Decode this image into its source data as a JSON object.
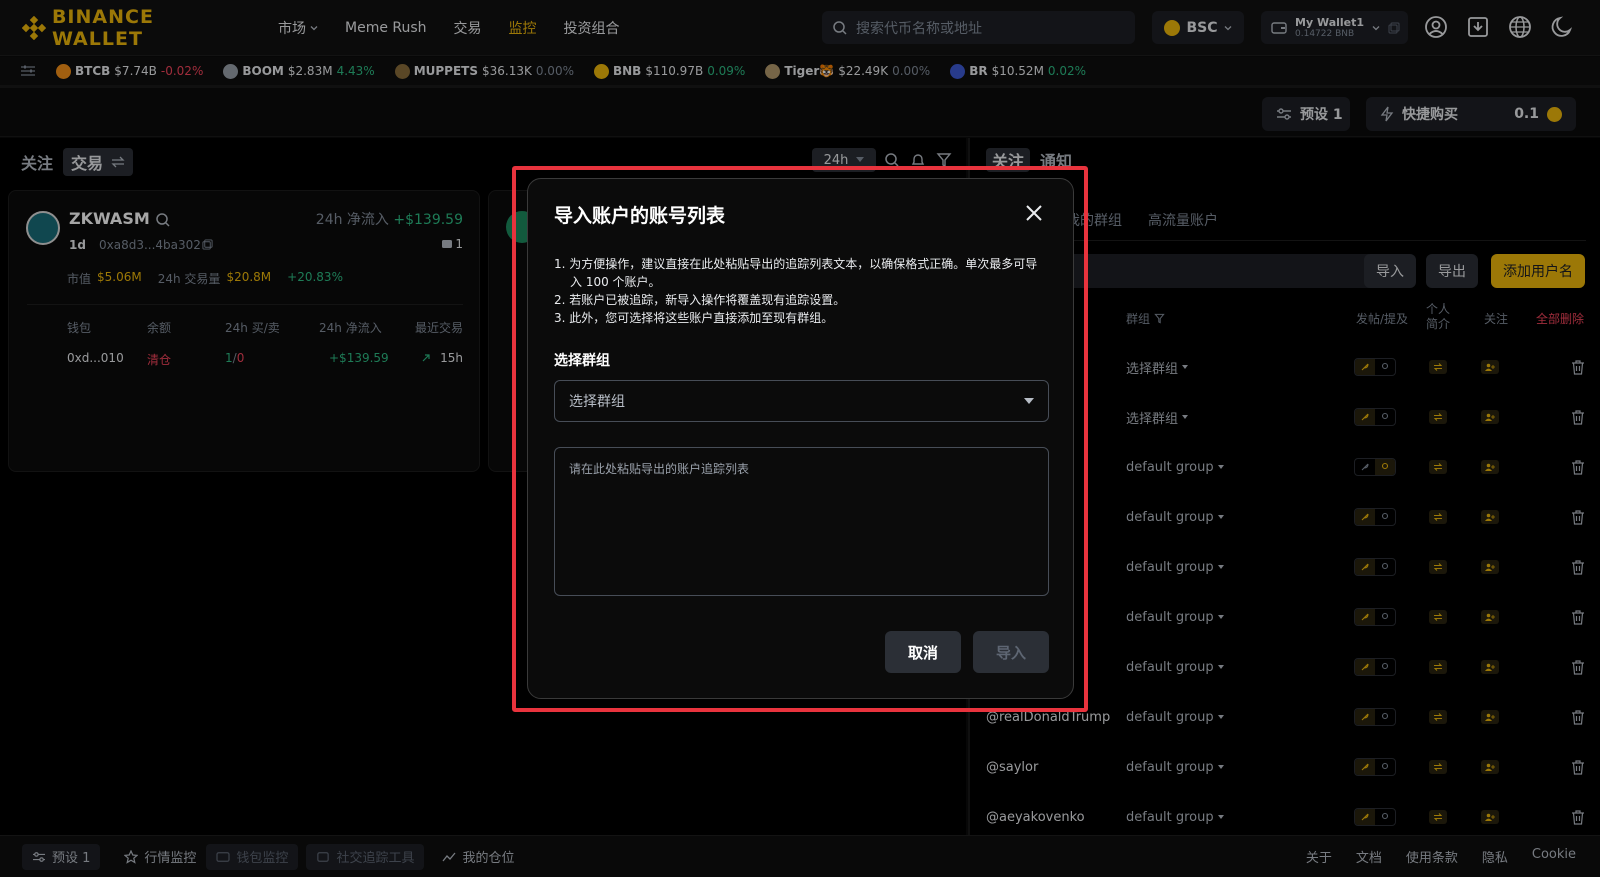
{
  "nav": {
    "brand": "BINANCE WALLET",
    "links": [
      {
        "label": "市场",
        "active": false,
        "dropdown": true
      },
      {
        "label": "Meme Rush",
        "active": false,
        "dropdown": false
      },
      {
        "label": "交易",
        "active": false,
        "dropdown": false
      },
      {
        "label": "监控",
        "active": true,
        "dropdown": false
      },
      {
        "label": "投资组合",
        "active": false,
        "dropdown": false
      }
    ],
    "search_placeholder": "搜索代币名称或地址",
    "chain": "BSC",
    "wallet_name": "My Wallet1",
    "wallet_balance": "0.14722 BNB"
  },
  "ticker": [
    {
      "symbol": "BTCB",
      "value": "$7.74B",
      "change": "-0.02%",
      "dir": "dn"
    },
    {
      "symbol": "BOOM",
      "value": "$2.83M",
      "change": "4.43%",
      "dir": "up"
    },
    {
      "symbol": "MUPPETS",
      "value": "$36.13K",
      "change": "0.00%",
      "dir": "flat"
    },
    {
      "symbol": "BNB",
      "value": "$110.97B",
      "change": "0.09%",
      "dir": "up"
    },
    {
      "symbol": "Tiger🐯",
      "value": "$22.49K",
      "change": "0.00%",
      "dir": "flat"
    },
    {
      "symbol": "BR",
      "value": "$10.52M",
      "change": "0.02%",
      "dir": "up"
    }
  ],
  "presets": {
    "preset_label": "预设 1",
    "quick_buy_label": "快捷购买",
    "quick_buy_amount": "0.1"
  },
  "left": {
    "tab_follow": "关注",
    "tab_trade": "交易",
    "timeframe": "24h",
    "card": {
      "name": "ZKWASM",
      "inflow_label": "24h 净流入",
      "inflow_value": "+$139.59",
      "age": "1d",
      "address": "0xa8d3...4ba302",
      "holders": "1",
      "mcap_label": "市值",
      "mcap_value": "$5.06M",
      "vol_label": "24h 交易量",
      "vol_value": "$20.8M",
      "change": "+20.83%",
      "cols": [
        "钱包",
        "余额",
        "24h 买/卖",
        "24h 净流入",
        "最近交易"
      ],
      "row": {
        "wallet": "0xd...010",
        "balance": "清仓",
        "buys": "1",
        "sep": "/",
        "sells": "0",
        "inflow": "+$139.59",
        "last": "15h"
      }
    }
  },
  "right": {
    "tab_follow": "关注",
    "tab_notify": "通知",
    "subtab_groups": "我的群组",
    "subtab_high": "高流量账户",
    "btn_import": "导入",
    "btn_export": "导出",
    "btn_add": "添加用户名",
    "col_group": "群组",
    "col_post": "发帖/提及",
    "col_bio": "个人简介",
    "col_follow": "关注",
    "col_delete_all": "全部删除",
    "rows": [
      {
        "name": "",
        "group": "选择群组"
      },
      {
        "name": "",
        "group": "选择群组"
      },
      {
        "name": "",
        "group": "default group"
      },
      {
        "name": "",
        "group": "default group"
      },
      {
        "name": "",
        "group": "default group"
      },
      {
        "name": "",
        "group": "default group"
      },
      {
        "name": "",
        "group": "default group"
      },
      {
        "name": "@realDonaldTrump",
        "group": "default group"
      },
      {
        "name": "@saylor",
        "group": "default group"
      },
      {
        "name": "@aeyakovenko",
        "group": "default group"
      }
    ]
  },
  "bottom": {
    "preset": "预设 1",
    "market_watch": "行情监控",
    "wallet_watch": "钱包监控",
    "social": "社交追踪工具",
    "positions": "我的仓位",
    "about": "关于",
    "docs": "文档",
    "terms": "使用条款",
    "privacy": "隐私",
    "cookie": "Cookie"
  },
  "modal": {
    "title": "导入账户的账号列表",
    "tips": [
      "1. 为方便操作，建议直接在此处粘贴导出的追踪列表文本，以确保格式正确。单次最多可导入 100 个账户。",
      "2. 若账户已被追踪，新导入操作将覆盖现有追踪设置。",
      "3. 此外，您可选择将这些账户直接添加至现有群组。"
    ],
    "group_label": "选择群组",
    "group_select": "选择群组",
    "textarea_placeholder": "请在此处粘贴导出的账户追踪列表",
    "cancel": "取消",
    "import": "导入"
  },
  "colors": {
    "accent": "#f0b90b",
    "up": "#2ebd85",
    "down": "#f6465d",
    "highlight_frame": "#e8333d"
  }
}
